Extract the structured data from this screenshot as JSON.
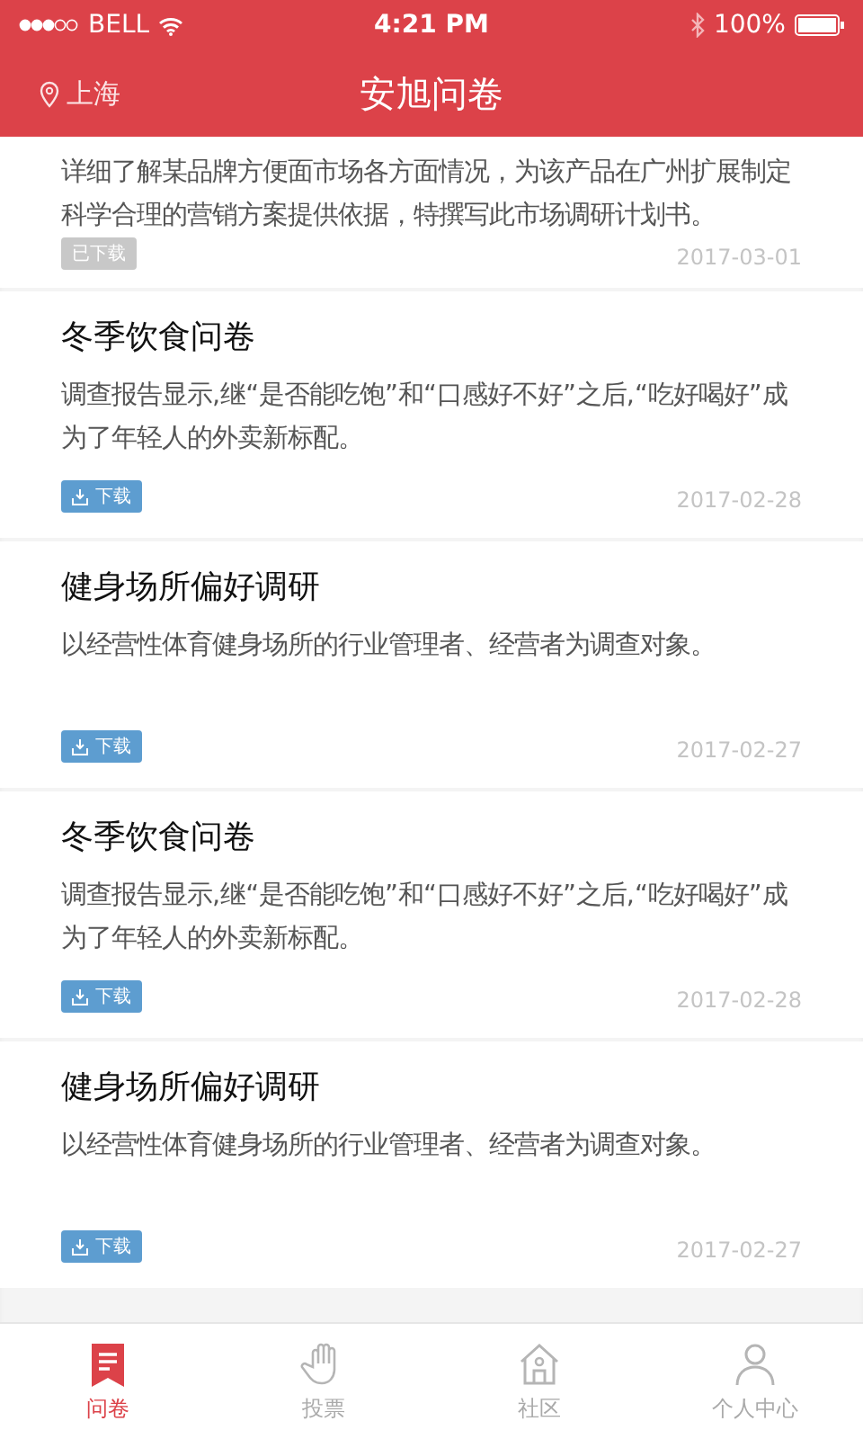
{
  "status_bar": {
    "carrier": "BELL",
    "time": "4:21 PM",
    "battery": "100%"
  },
  "header": {
    "location": "上海",
    "title": "安旭问卷"
  },
  "surveys": [
    {
      "description": "详细了解某品牌方便面市场各方面情况，为该产品在广州扩展制定科学合理的营销方案提供依据，特撰写此市场调研计划书。",
      "tag": "已下载",
      "downloaded": true,
      "date": "2017-03-01"
    },
    {
      "title": "冬季饮食问卷",
      "description": "调查报告显示,继“是否能吃饱”和“口感好不好”之后,“吃好喝好”成为了年轻人的外卖新标配。",
      "tag": "下载",
      "downloaded": false,
      "date": "2017-02-28"
    },
    {
      "title": "健身场所偏好调研",
      "description": "以经营性体育健身场所的行业管理者、经营者为调查对象。",
      "tag": "下载",
      "downloaded": false,
      "date": "2017-02-27"
    },
    {
      "title": "冬季饮食问卷",
      "description": "调查报告显示,继“是否能吃饱”和“口感好不好”之后,“吃好喝好”成为了年轻人的外卖新标配。",
      "tag": "下载",
      "downloaded": false,
      "date": "2017-02-28"
    },
    {
      "title": "健身场所偏好调研",
      "description": "以经营性体育健身场所的行业管理者、经营者为调查对象。",
      "tag": "下载",
      "downloaded": false,
      "date": "2017-02-27"
    }
  ],
  "tab_bar": [
    {
      "label": "问卷",
      "kind": "survey",
      "selected": true
    },
    {
      "label": "投票",
      "kind": "vote",
      "selected": false
    },
    {
      "label": "社区",
      "kind": "community",
      "selected": false
    },
    {
      "label": "个人中心",
      "kind": "profile",
      "selected": false
    }
  ]
}
